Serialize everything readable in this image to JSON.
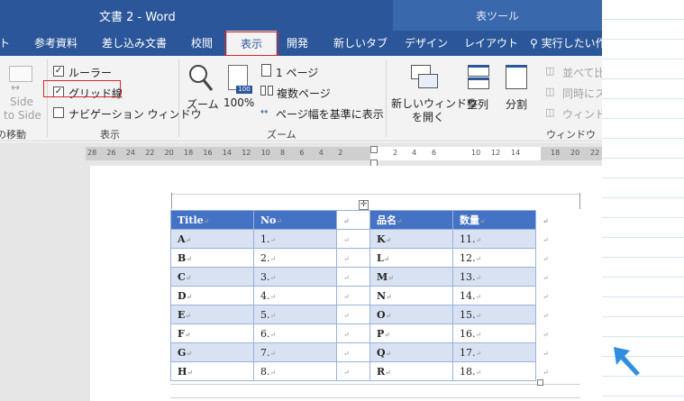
{
  "window": {
    "title": "文書 2  -  Word",
    "table_tools": "表ツール"
  },
  "tabs": [
    {
      "label": "ト",
      "active": false
    },
    {
      "label": "参考資料",
      "active": false
    },
    {
      "label": "差し込み文書",
      "active": false
    },
    {
      "label": "校閲",
      "active": false
    },
    {
      "label": "表示",
      "active": true
    },
    {
      "label": "開発",
      "active": false
    },
    {
      "label": "新しいタブ",
      "active": false
    },
    {
      "label": "デザイン",
      "active": false
    },
    {
      "label": "レイアウト",
      "active": false
    }
  ],
  "tell_me": "実行したい作",
  "ribbon": {
    "side_by_side": {
      "line1": "Side",
      "line2": "to Side",
      "group": "の移動"
    },
    "show": {
      "group": "表示",
      "ruler": "ルーラー",
      "gridlines": "グリッド線",
      "nav": "ナビゲーション ウィンドウ",
      "ruler_checked": true,
      "gridlines_checked": true,
      "nav_checked": false
    },
    "zoom": {
      "group": "ズーム",
      "zoom": "ズーム",
      "hundred": "100%",
      "hundred_badge": "100",
      "one_page": "1 ページ",
      "multi_page": "複数ページ",
      "page_width": "ページ幅を基準に表示"
    },
    "window": {
      "group": "ウィンドウ",
      "new_window_1": "新しいウィンドウ",
      "new_window_2": "を開く",
      "arrange": "整列",
      "split": "分割",
      "side_compare": "並べて比",
      "sync_scroll": "同時にス",
      "reset_pos": "ウィンドウ"
    }
  },
  "ruler": {
    "left_ticks": [
      "28",
      "26",
      "24",
      "22",
      "20",
      "18",
      "16",
      "14",
      "12",
      "10",
      "8",
      "6",
      "4",
      "2"
    ],
    "right_ticks": [
      "2",
      "4",
      "6",
      "10",
      "12",
      "14",
      "18",
      "20",
      "22"
    ]
  },
  "table": {
    "headers": [
      "Title",
      "No",
      "品名",
      "数量"
    ],
    "rows": [
      [
        "A",
        "1.",
        "K",
        "11."
      ],
      [
        "B",
        "2.",
        "L",
        "12."
      ],
      [
        "C",
        "3.",
        "M",
        "13."
      ],
      [
        "D",
        "4.",
        "N",
        "14."
      ],
      [
        "E",
        "5.",
        "O",
        "15."
      ],
      [
        "F",
        "6.",
        "P",
        "16."
      ],
      [
        "G",
        "7.",
        "Q",
        "17."
      ],
      [
        "H",
        "8.",
        "R",
        "18."
      ]
    ]
  },
  "colors": {
    "word_blue": "#2b579a",
    "table_header": "#4472c4",
    "table_band": "#d9e2f3",
    "highlight": "#d9262c",
    "arrow": "#2f8fde"
  }
}
